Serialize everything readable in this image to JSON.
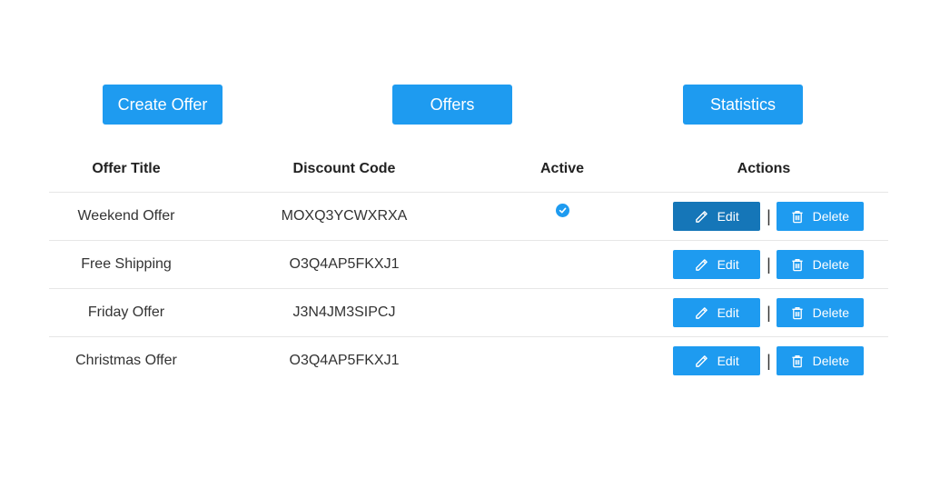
{
  "toolbar": {
    "create_label": "Create Offer",
    "offers_label": "Offers",
    "stats_label": "Statistics"
  },
  "table": {
    "headers": [
      "Offer Title",
      "Discount Code",
      "Active",
      "Actions"
    ],
    "rows": [
      {
        "title": "Weekend Offer",
        "code": "MOXQ3YCWXRXA",
        "active": true
      },
      {
        "title": "Free Shipping",
        "code": "O3Q4AP5FKXJ1",
        "active": false
      },
      {
        "title": "Friday Offer",
        "code": "J3N4JM3SIPCJ",
        "active": false
      },
      {
        "title": "Christmas Offer",
        "code": "O3Q4AP5FKXJ1",
        "active": false
      }
    ],
    "edit_label": "Edit",
    "delete_label": "Delete",
    "separator": "|"
  },
  "colors": {
    "accent": "#1e9bf0",
    "accent_pressed": "#1576b8"
  },
  "icons": {
    "active": "check-circle-icon",
    "edit": "pencil-icon",
    "delete": "trash-icon"
  }
}
